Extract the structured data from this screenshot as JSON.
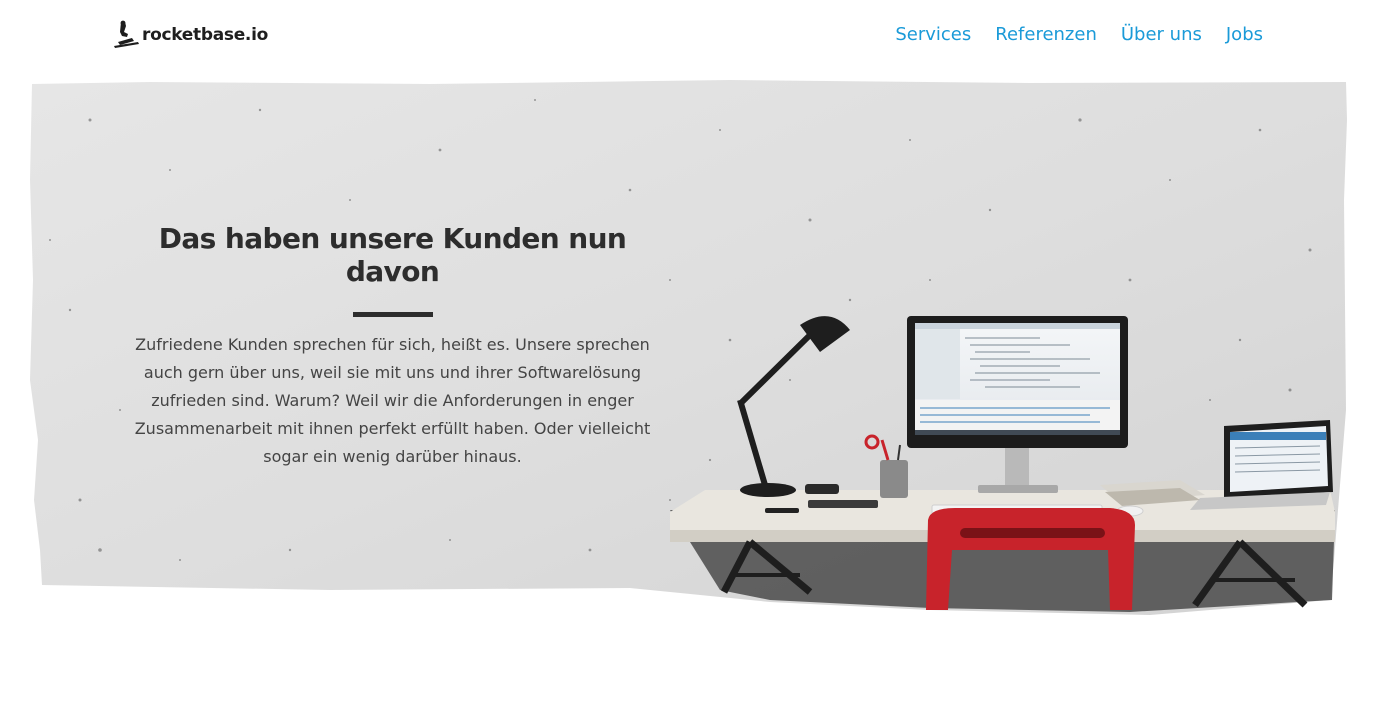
{
  "brand": {
    "logo_text": "rocketbase.io",
    "logo_icon": "rocket-rider-icon"
  },
  "nav": {
    "items": [
      {
        "label": "Services"
      },
      {
        "label": "Referenzen"
      },
      {
        "label": "Über uns"
      },
      {
        "label": "Jobs"
      }
    ]
  },
  "hero": {
    "title": "Das haben unsere Kunden nun davon",
    "body": "Zufriedene Kunden sprechen für sich, heißt es. Unsere sprechen auch gern über uns, weil sie mit uns und ihrer Softwarelösung zufrieden sind. Warum? Weil wir die Anforderungen in enger Zusammenarbeit mit ihnen perfekt erfüllt haben. Oder vielleicht sogar ein wenig darüber hinaus.",
    "image": "concrete-wall-desk-workspace-illustration"
  },
  "colors": {
    "nav_link": "#1a9ad8",
    "heading": "#2d2d2d",
    "concrete": "#dcdcdc",
    "chair": "#c8232b"
  }
}
